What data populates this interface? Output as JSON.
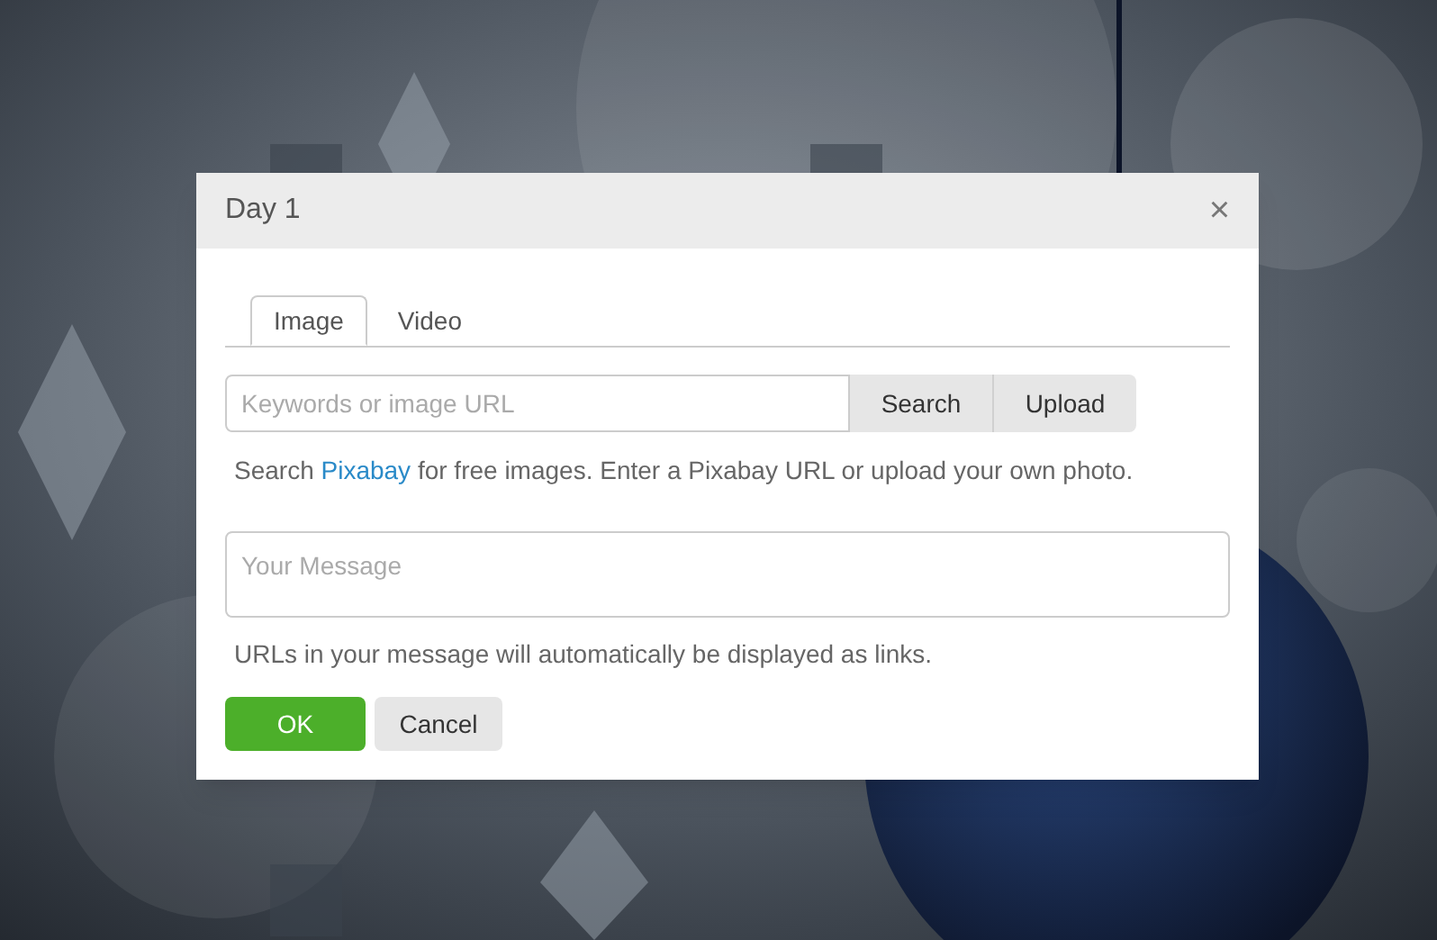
{
  "dialog": {
    "title": "Day 1",
    "close": "×",
    "tabs": [
      {
        "label": "Image",
        "selected": true
      },
      {
        "label": "Video",
        "selected": false
      }
    ],
    "search": {
      "placeholder": "Keywords or image URL",
      "buttons": [
        "Search",
        "Upload"
      ]
    },
    "help": {
      "before": "Search ",
      "link": "Pixabay",
      "after": " for free images. Enter a Pixabay URL or upload your own photo."
    },
    "message": {
      "placeholder": "Your Message"
    },
    "message_note": "URLs in your message will automatically be displayed as links.",
    "ok": "OK",
    "cancel": "Cancel"
  }
}
